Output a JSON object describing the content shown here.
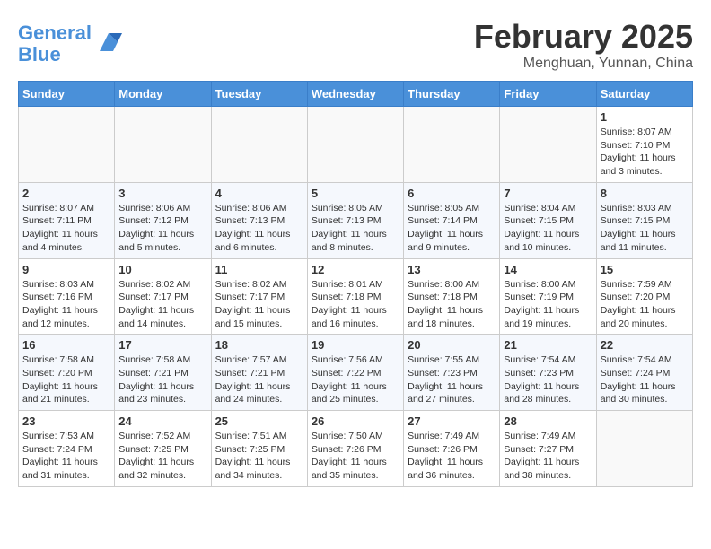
{
  "logo": {
    "line1": "General",
    "line2": "Blue"
  },
  "title": "February 2025",
  "subtitle": "Menghuan, Yunnan, China",
  "weekdays": [
    "Sunday",
    "Monday",
    "Tuesday",
    "Wednesday",
    "Thursday",
    "Friday",
    "Saturday"
  ],
  "weeks": [
    [
      {
        "day": "",
        "info": ""
      },
      {
        "day": "",
        "info": ""
      },
      {
        "day": "",
        "info": ""
      },
      {
        "day": "",
        "info": ""
      },
      {
        "day": "",
        "info": ""
      },
      {
        "day": "",
        "info": ""
      },
      {
        "day": "1",
        "info": "Sunrise: 8:07 AM\nSunset: 7:10 PM\nDaylight: 11 hours\nand 3 minutes."
      }
    ],
    [
      {
        "day": "2",
        "info": "Sunrise: 8:07 AM\nSunset: 7:11 PM\nDaylight: 11 hours\nand 4 minutes."
      },
      {
        "day": "3",
        "info": "Sunrise: 8:06 AM\nSunset: 7:12 PM\nDaylight: 11 hours\nand 5 minutes."
      },
      {
        "day": "4",
        "info": "Sunrise: 8:06 AM\nSunset: 7:13 PM\nDaylight: 11 hours\nand 6 minutes."
      },
      {
        "day": "5",
        "info": "Sunrise: 8:05 AM\nSunset: 7:13 PM\nDaylight: 11 hours\nand 8 minutes."
      },
      {
        "day": "6",
        "info": "Sunrise: 8:05 AM\nSunset: 7:14 PM\nDaylight: 11 hours\nand 9 minutes."
      },
      {
        "day": "7",
        "info": "Sunrise: 8:04 AM\nSunset: 7:15 PM\nDaylight: 11 hours\nand 10 minutes."
      },
      {
        "day": "8",
        "info": "Sunrise: 8:03 AM\nSunset: 7:15 PM\nDaylight: 11 hours\nand 11 minutes."
      }
    ],
    [
      {
        "day": "9",
        "info": "Sunrise: 8:03 AM\nSunset: 7:16 PM\nDaylight: 11 hours\nand 12 minutes."
      },
      {
        "day": "10",
        "info": "Sunrise: 8:02 AM\nSunset: 7:17 PM\nDaylight: 11 hours\nand 14 minutes."
      },
      {
        "day": "11",
        "info": "Sunrise: 8:02 AM\nSunset: 7:17 PM\nDaylight: 11 hours\nand 15 minutes."
      },
      {
        "day": "12",
        "info": "Sunrise: 8:01 AM\nSunset: 7:18 PM\nDaylight: 11 hours\nand 16 minutes."
      },
      {
        "day": "13",
        "info": "Sunrise: 8:00 AM\nSunset: 7:18 PM\nDaylight: 11 hours\nand 18 minutes."
      },
      {
        "day": "14",
        "info": "Sunrise: 8:00 AM\nSunset: 7:19 PM\nDaylight: 11 hours\nand 19 minutes."
      },
      {
        "day": "15",
        "info": "Sunrise: 7:59 AM\nSunset: 7:20 PM\nDaylight: 11 hours\nand 20 minutes."
      }
    ],
    [
      {
        "day": "16",
        "info": "Sunrise: 7:58 AM\nSunset: 7:20 PM\nDaylight: 11 hours\nand 21 minutes."
      },
      {
        "day": "17",
        "info": "Sunrise: 7:58 AM\nSunset: 7:21 PM\nDaylight: 11 hours\nand 23 minutes."
      },
      {
        "day": "18",
        "info": "Sunrise: 7:57 AM\nSunset: 7:21 PM\nDaylight: 11 hours\nand 24 minutes."
      },
      {
        "day": "19",
        "info": "Sunrise: 7:56 AM\nSunset: 7:22 PM\nDaylight: 11 hours\nand 25 minutes."
      },
      {
        "day": "20",
        "info": "Sunrise: 7:55 AM\nSunset: 7:23 PM\nDaylight: 11 hours\nand 27 minutes."
      },
      {
        "day": "21",
        "info": "Sunrise: 7:54 AM\nSunset: 7:23 PM\nDaylight: 11 hours\nand 28 minutes."
      },
      {
        "day": "22",
        "info": "Sunrise: 7:54 AM\nSunset: 7:24 PM\nDaylight: 11 hours\nand 30 minutes."
      }
    ],
    [
      {
        "day": "23",
        "info": "Sunrise: 7:53 AM\nSunset: 7:24 PM\nDaylight: 11 hours\nand 31 minutes."
      },
      {
        "day": "24",
        "info": "Sunrise: 7:52 AM\nSunset: 7:25 PM\nDaylight: 11 hours\nand 32 minutes."
      },
      {
        "day": "25",
        "info": "Sunrise: 7:51 AM\nSunset: 7:25 PM\nDaylight: 11 hours\nand 34 minutes."
      },
      {
        "day": "26",
        "info": "Sunrise: 7:50 AM\nSunset: 7:26 PM\nDaylight: 11 hours\nand 35 minutes."
      },
      {
        "day": "27",
        "info": "Sunrise: 7:49 AM\nSunset: 7:26 PM\nDaylight: 11 hours\nand 36 minutes."
      },
      {
        "day": "28",
        "info": "Sunrise: 7:49 AM\nSunset: 7:27 PM\nDaylight: 11 hours\nand 38 minutes."
      },
      {
        "day": "",
        "info": ""
      }
    ]
  ]
}
